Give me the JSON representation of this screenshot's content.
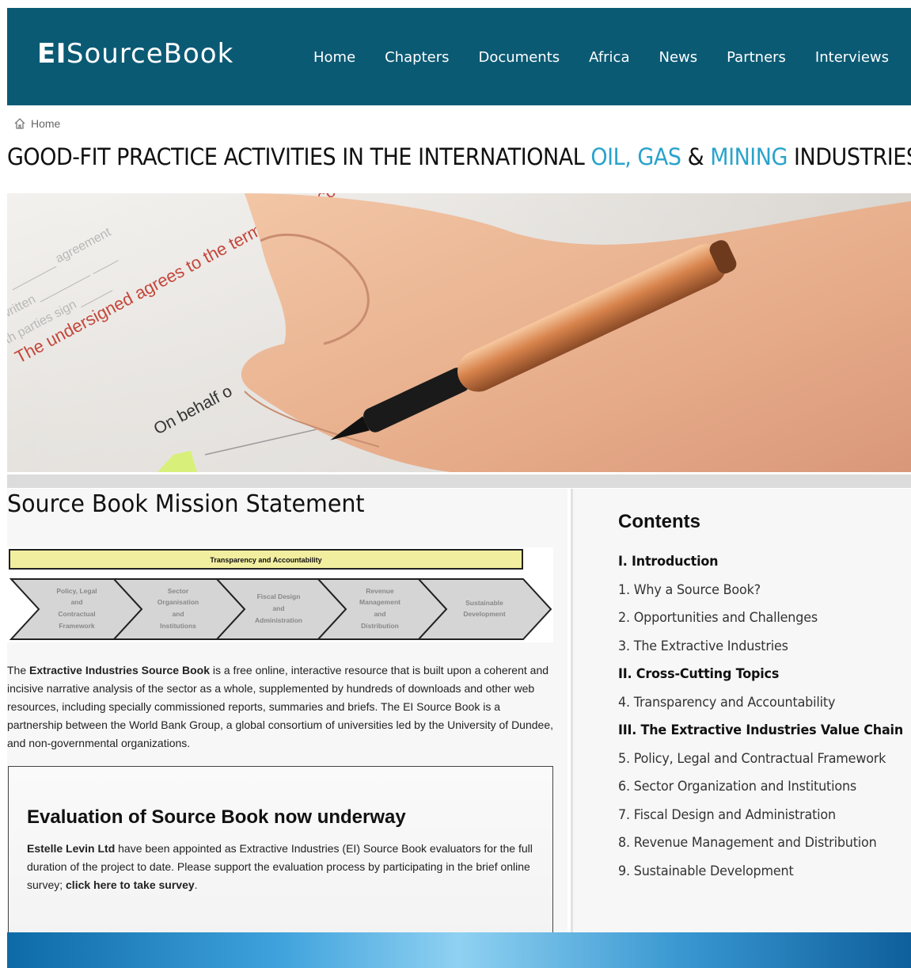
{
  "header": {
    "logo_ei": "EI",
    "logo_sourcebook": "SourceBook",
    "nav": [
      "Home",
      "Chapters",
      "Documents",
      "Africa",
      "News",
      "Partners",
      "Interviews"
    ]
  },
  "breadcrumb": {
    "home": "Home"
  },
  "title": {
    "part1": "GOOD-FIT PRACTICE ACTIVITIES IN THE INTERNATIONAL ",
    "oil_gas": "OIL, GAS",
    "amp": " & ",
    "mining": "MINING",
    "part2": " INDUSTRIES"
  },
  "hero": {
    "line1": "The undersigned agrees to the terms of this co",
    "line2": "On behalf o"
  },
  "mission": {
    "title": "Source Book Mission Statement",
    "diagram_banner": "Transparency and Accountability",
    "diagram_steps": [
      [
        "Policy, Legal",
        "and",
        "Contractual",
        "Framework"
      ],
      [
        "Sector",
        "Organisation",
        "and",
        "Institutions"
      ],
      [
        "Fiscal Design",
        "and",
        "Administration"
      ],
      [
        "Revenue",
        "Management",
        "and",
        "Distribution"
      ],
      [
        "Sustainable",
        "Development"
      ]
    ],
    "text_the": "The ",
    "text_bold": "Extractive Industries Source Book",
    "text_rest": " is a free online, interactive resource that is built upon a coherent and incisive narrative analysis of the sector as a whole, supplemented by hundreds of downloads and other web resources, including specially commissioned reports, summaries and briefs. The EI Source Book is a partnership between the World Bank Group, a global consortium of universities led by the University of Dundee, and non-governmental organizations."
  },
  "evaluation": {
    "title": "Evaluation of Source Book now underway",
    "bold_start": "Estelle Levin Ltd",
    "text1": " have been appointed as Extractive Industries (EI) Source Book evaluators for the full duration of the project to date.  Please support the evaluation process by participating in the brief online survey; ",
    "link": "click here to take survey",
    "end": "."
  },
  "contents": {
    "title": "Contents",
    "items": [
      {
        "label": "I. Introduction",
        "section": true
      },
      {
        "label": "1. Why a Source Book?",
        "section": false
      },
      {
        "label": "2. Opportunities and Challenges",
        "section": false
      },
      {
        "label": "3. The Extractive Industries",
        "section": false
      },
      {
        "label": "II. Cross-Cutting Topics",
        "section": true
      },
      {
        "label": "4. Transparency and Accountability",
        "section": false
      },
      {
        "label": "III. The Extractive Industries Value Chain",
        "section": true
      },
      {
        "label": "5. Policy, Legal and Contractual Framework",
        "section": false
      },
      {
        "label": "6. Sector Organization and Institutions",
        "section": false
      },
      {
        "label": "7. Fiscal Design and Administration",
        "section": false
      },
      {
        "label": "8. Revenue Management and Distribution",
        "section": false
      },
      {
        "label": "9. Sustainable Development",
        "section": false
      }
    ]
  },
  "colors": {
    "header_bg": "#0b5a74",
    "accent": "#29a3cc"
  }
}
